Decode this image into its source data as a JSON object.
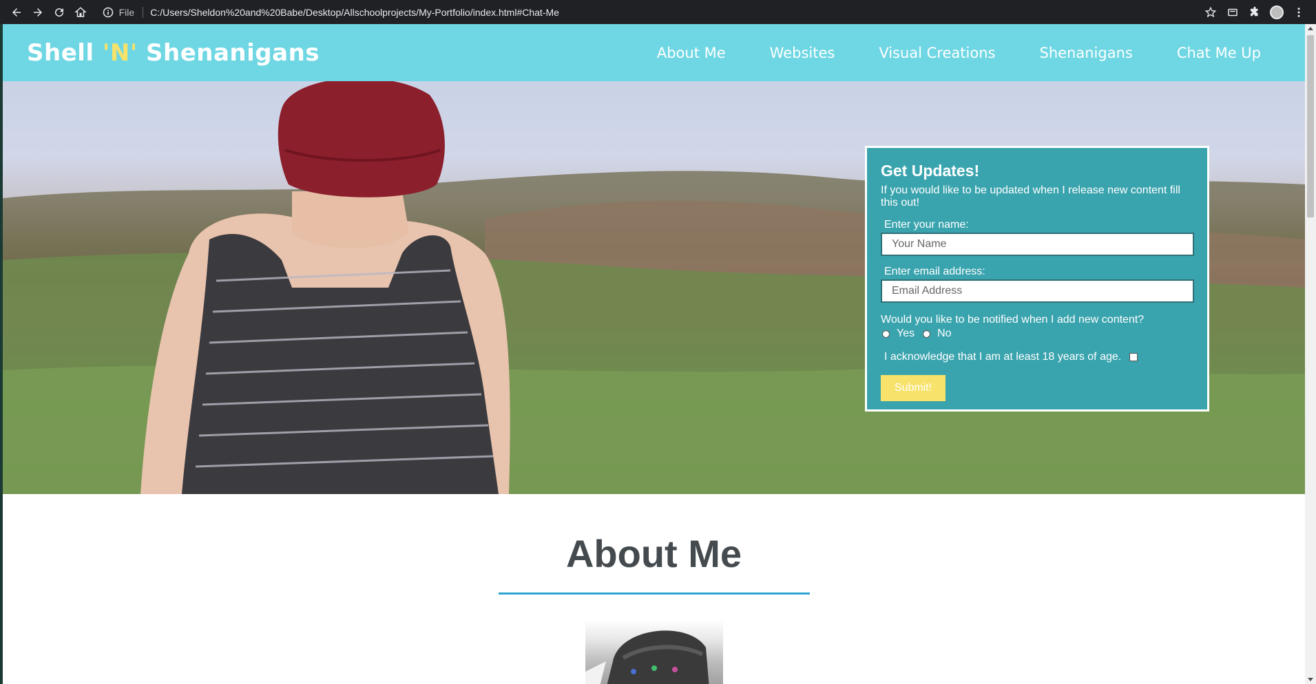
{
  "browser": {
    "file_label": "File",
    "url": "C:/Users/Sheldon%20and%20Babe/Desktop/Allschoolprojects/My-Portfolio/index.html#Chat-Me"
  },
  "site": {
    "brand_part1": "Shell ",
    "brand_accent": "'N'",
    "brand_part2": " Shenanigans",
    "nav": [
      "About Me",
      "Websites",
      "Visual Creations",
      "Shenanigans",
      "Chat Me Up"
    ],
    "colors": {
      "header": "#6fd7e3",
      "accent": "#f7e26b",
      "form_bg": "#3aa4ae",
      "rule": "#2aa3d0"
    }
  },
  "form": {
    "title": "Get Updates!",
    "description": "If you would like to be updated when I release new content fill this out!",
    "name_label": "Enter your name:",
    "name_placeholder": "Your Name",
    "email_label": "Enter email address:",
    "email_placeholder": "Email Address",
    "question": "Would you like to be notified when I add new content?",
    "yes_label": "Yes",
    "no_label": "No",
    "ack_label": "I acknowledge that I am at least 18 years of age.",
    "submit_label": "Submit!"
  },
  "about": {
    "title": "About Me"
  }
}
